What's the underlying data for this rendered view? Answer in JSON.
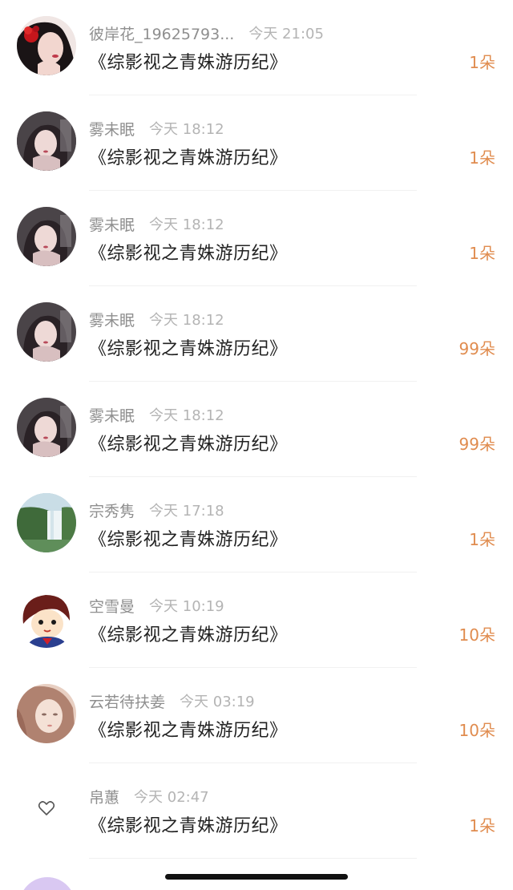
{
  "colors": {
    "count_accent": "#e08c4f",
    "name_gray": "#8f8f8f",
    "time_gray": "#b4b4b4",
    "title_text": "#222222"
  },
  "items": [
    {
      "name": "彼岸花_19625793...",
      "time": "今天 21:05",
      "title": "《综影视之青姝游历纪》",
      "count": "1朵",
      "avatar": "red-flower-girl-avatar"
    },
    {
      "name": "雾未眠",
      "time": "今天 18:12",
      "title": "《综影视之青姝游历纪》",
      "count": "1朵",
      "avatar": "dark-hair-girl-avatar"
    },
    {
      "name": "雾未眠",
      "time": "今天 18:12",
      "title": "《综影视之青姝游历纪》",
      "count": "1朵",
      "avatar": "dark-hair-girl-avatar"
    },
    {
      "name": "雾未眠",
      "time": "今天 18:12",
      "title": "《综影视之青姝游历纪》",
      "count": "99朵",
      "avatar": "dark-hair-girl-avatar"
    },
    {
      "name": "雾未眠",
      "time": "今天 18:12",
      "title": "《综影视之青姝游历纪》",
      "count": "99朵",
      "avatar": "dark-hair-girl-avatar"
    },
    {
      "name": "宗秀隽",
      "time": "今天 17:18",
      "title": "《综影视之青姝游历纪》",
      "count": "1朵",
      "avatar": "waterfall-avatar"
    },
    {
      "name": "空雪曼",
      "time": "今天 10:19",
      "title": "《综影视之青姝游历纪》",
      "count": "10朵",
      "avatar": "cartoon-girl-avatar"
    },
    {
      "name": "云若待扶姜",
      "time": "今天 03:19",
      "title": "《综影视之青姝游历纪》",
      "count": "10朵",
      "avatar": "pale-girl-avatar"
    },
    {
      "name": "帛蕙",
      "time": "今天 02:47",
      "title": "《综影视之青姝游历纪》",
      "count": "1朵",
      "avatar": "heart-icon"
    }
  ]
}
